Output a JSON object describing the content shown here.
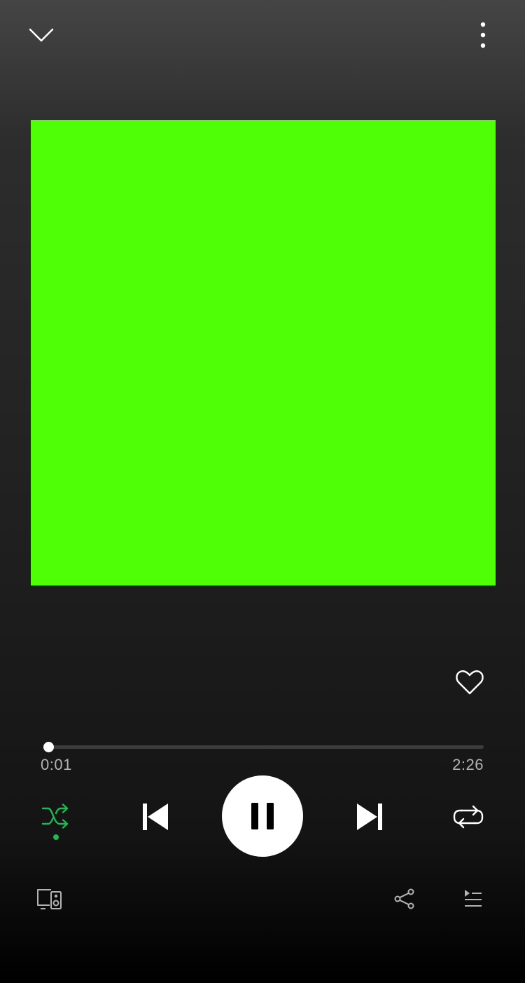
{
  "player": {
    "album_art_color": "#4eff05",
    "elapsed": "0:01",
    "duration": "2:26",
    "progress_fraction": 0.007,
    "liked": false,
    "is_playing": true,
    "shuffle_enabled": true,
    "repeat_enabled": false
  },
  "colors": {
    "accent": "#1db954",
    "icon": "#ffffff",
    "secondary_text": "#b3b3b3"
  },
  "icons": {
    "collapse": "chevron-down-icon",
    "more": "more-vertical-icon",
    "like": "heart-icon",
    "shuffle": "shuffle-icon",
    "previous": "skip-previous-icon",
    "play_pause": "pause-icon",
    "next": "skip-next-icon",
    "repeat": "repeat-icon",
    "devices": "devices-icon",
    "share": "share-icon",
    "queue": "queue-icon"
  }
}
